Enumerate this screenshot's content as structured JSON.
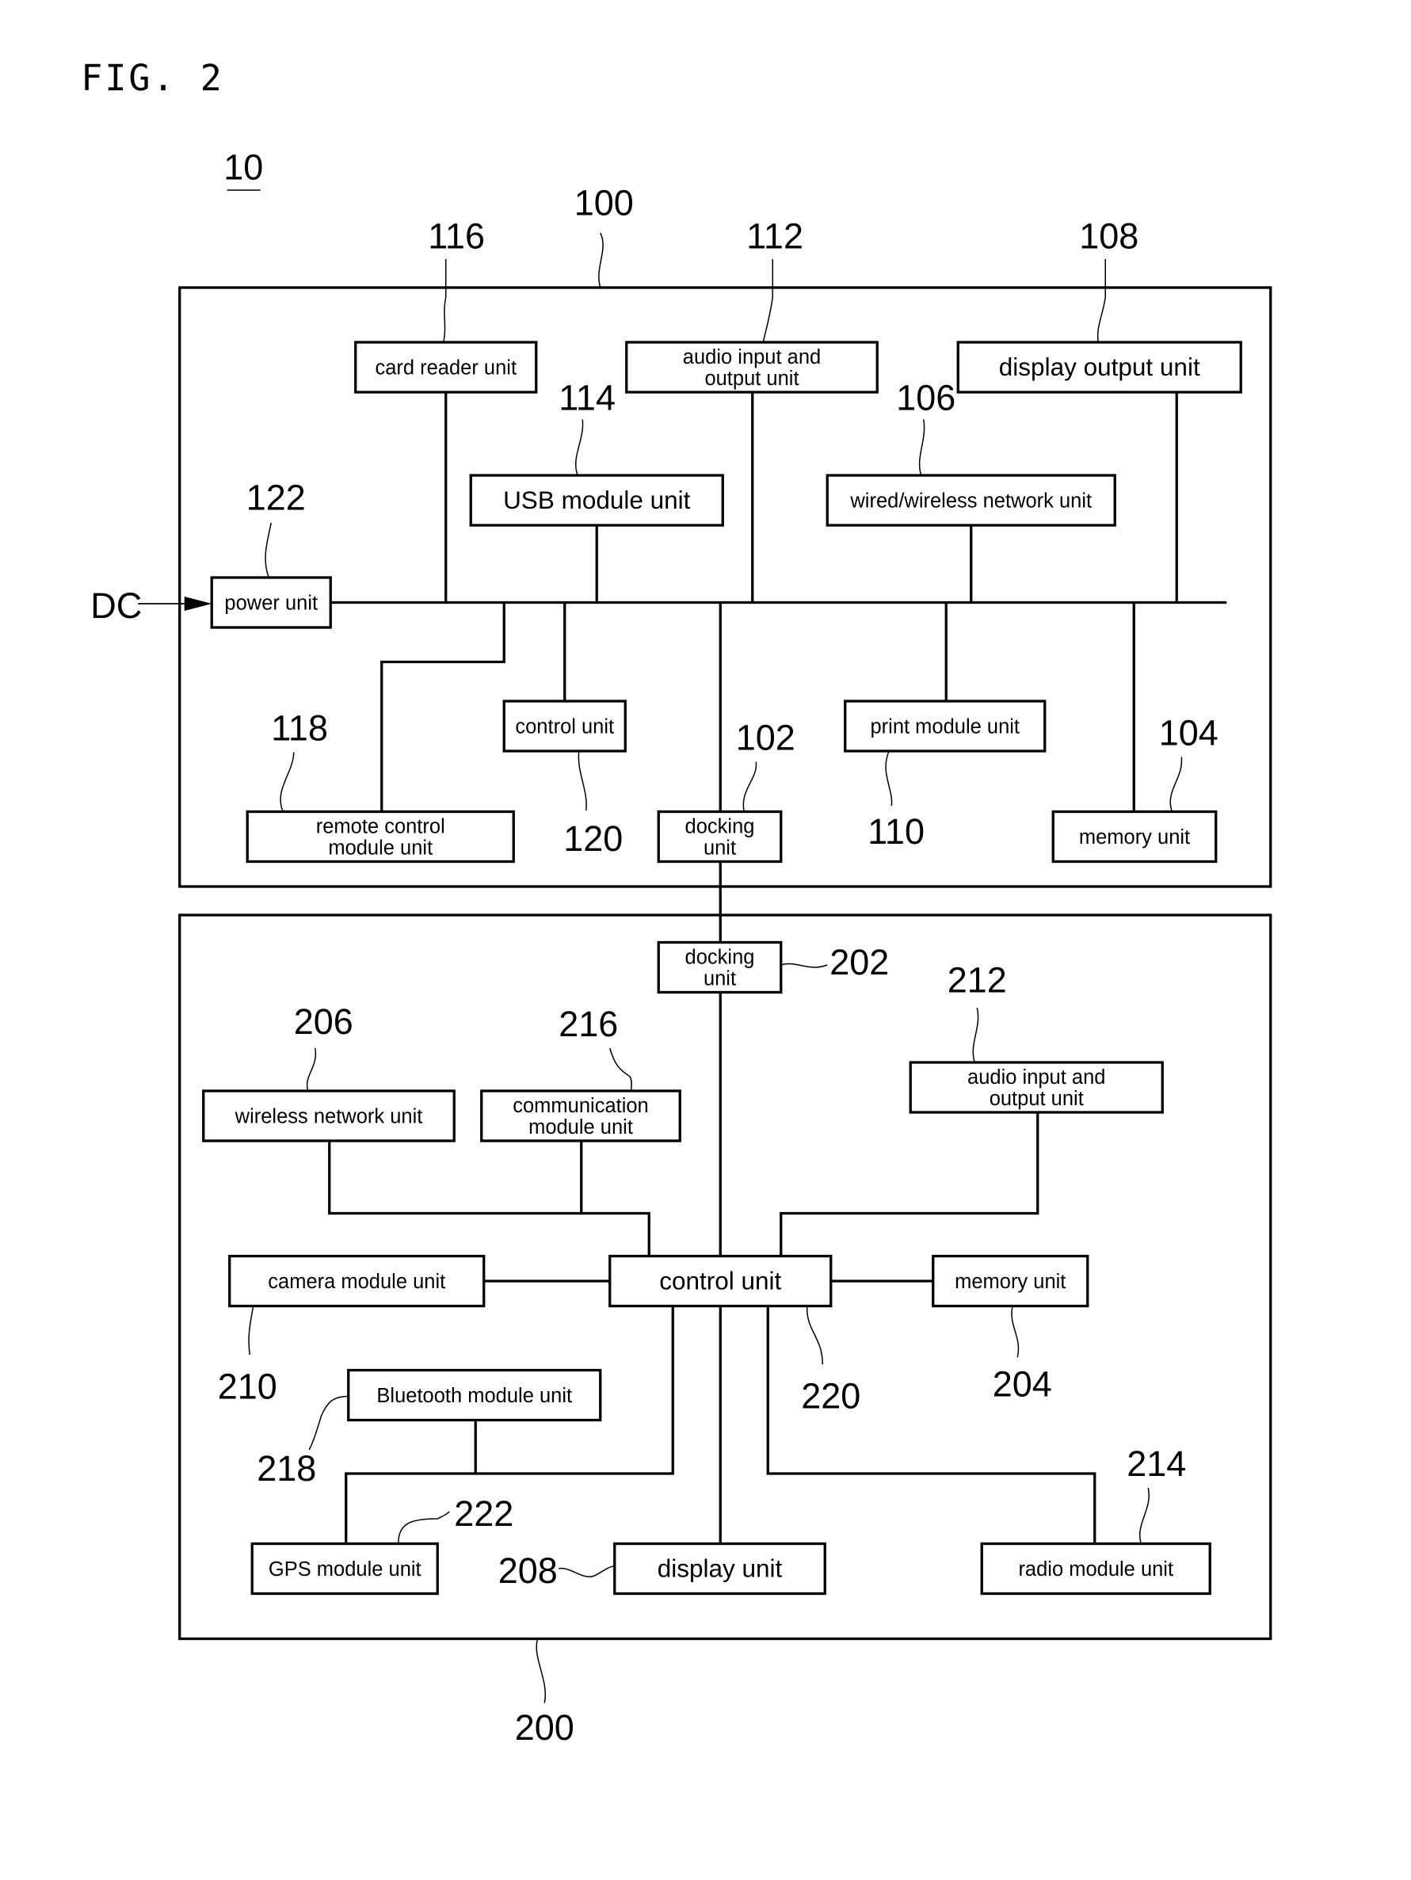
{
  "figure": {
    "title": "FIG. 2",
    "system_ref": "10",
    "input_label": "DC"
  },
  "device_100": {
    "ref": "100",
    "blocks": {
      "card_reader": {
        "ref": "116",
        "lines": [
          "card reader unit"
        ]
      },
      "audio_io": {
        "ref": "112",
        "lines": [
          "audio input and",
          "output unit"
        ]
      },
      "display_output": {
        "ref": "108",
        "lines": [
          "display output unit"
        ]
      },
      "usb_module": {
        "ref": "114",
        "lines": [
          "USB module unit"
        ]
      },
      "network": {
        "ref": "106",
        "lines": [
          "wired/wireless network unit"
        ]
      },
      "power": {
        "ref": "122",
        "lines": [
          "power unit"
        ]
      },
      "control": {
        "ref": "120",
        "lines": [
          "control unit"
        ]
      },
      "print_module": {
        "ref": "110",
        "lines": [
          "print module unit"
        ]
      },
      "remote_control": {
        "ref": "118",
        "lines": [
          "remote control",
          "module unit"
        ]
      },
      "docking": {
        "ref": "102",
        "lines": [
          "docking",
          "unit"
        ]
      },
      "memory": {
        "ref": "104",
        "lines": [
          "memory unit"
        ]
      }
    }
  },
  "device_200": {
    "ref": "200",
    "blocks": {
      "docking": {
        "ref": "202",
        "lines": [
          "docking",
          "unit"
        ]
      },
      "wireless_network": {
        "ref": "206",
        "lines": [
          "wireless network unit"
        ]
      },
      "communication_module": {
        "ref": "216",
        "lines": [
          "communication",
          "module unit"
        ]
      },
      "audio_io": {
        "ref": "212",
        "lines": [
          "audio input and",
          "output unit"
        ]
      },
      "camera_module": {
        "ref": "210",
        "lines": [
          "camera module unit"
        ]
      },
      "control": {
        "ref": "220",
        "lines": [
          "control unit"
        ]
      },
      "memory": {
        "ref": "204",
        "lines": [
          "memory unit"
        ]
      },
      "bluetooth_module": {
        "ref": "218",
        "lines": [
          "Bluetooth module unit"
        ]
      },
      "gps_module": {
        "ref": "222",
        "lines": [
          "GPS module unit"
        ]
      },
      "display": {
        "ref": "208",
        "lines": [
          "display unit"
        ]
      },
      "radio_module": {
        "ref": "214",
        "lines": [
          "radio module unit"
        ]
      }
    }
  }
}
